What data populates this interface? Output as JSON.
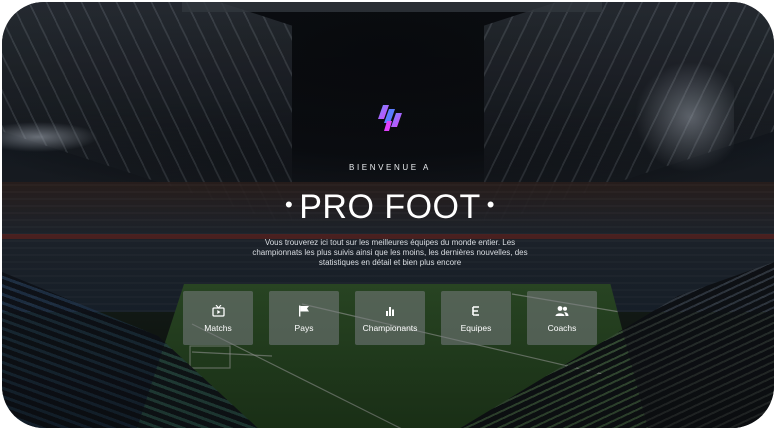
{
  "hero": {
    "welcome": "BIENVENUE A",
    "title": "PRO FOOT",
    "title_bullet": "•",
    "description": "Vous trouverez ici tout sur les meilleures équipes du monde entier. Les championnats les plus suivis ainsi que les moins, les dernières nouvelles, des statistiques en détail et bien plus encore"
  },
  "logo": {
    "icon": "pro-foot-logo",
    "colors": [
      "#6c8cff",
      "#e040fb"
    ]
  },
  "nav_cards": [
    {
      "label": "Matchs",
      "icon": "tv-icon"
    },
    {
      "label": "Pays",
      "icon": "flag-icon"
    },
    {
      "label": "Championants",
      "icon": "bar-chart-icon"
    },
    {
      "label": "Equipes",
      "icon": "e-letter-icon"
    },
    {
      "label": "Coachs",
      "icon": "users-icon"
    }
  ],
  "theme": {
    "text": "#ffffff",
    "card_bg": "rgba(120,124,128,0.55)"
  }
}
